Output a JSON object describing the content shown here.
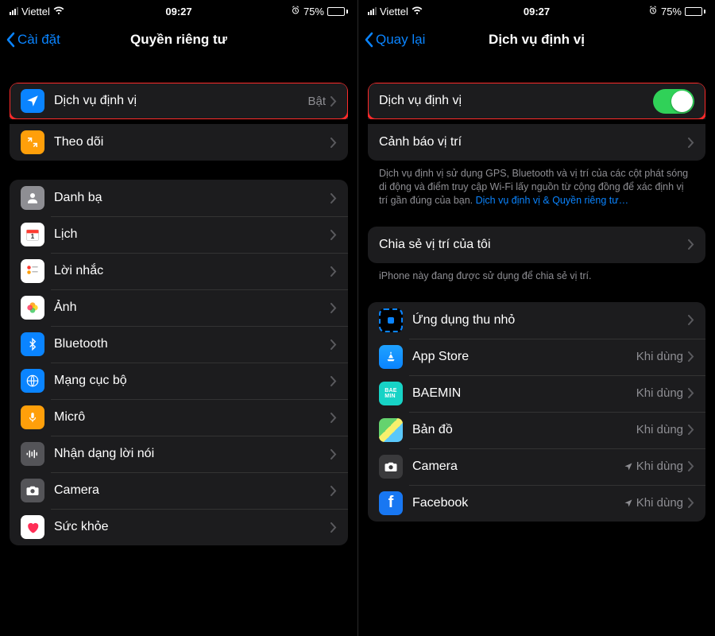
{
  "status": {
    "carrier": "Viettel",
    "time": "09:27",
    "battery_pct": "75%"
  },
  "left": {
    "back": "Cài đặt",
    "title": "Quyền riêng tư",
    "group1": [
      {
        "label": "Dịch vụ định vị",
        "value": "Bật",
        "icon": "location",
        "bg": "bg-blue"
      },
      {
        "label": "Theo dõi",
        "icon": "tracking",
        "bg": "bg-orange"
      }
    ],
    "group2": [
      {
        "label": "Danh bạ",
        "icon": "contacts"
      },
      {
        "label": "Lịch",
        "icon": "calendar"
      },
      {
        "label": "Lời nhắc",
        "icon": "reminders"
      },
      {
        "label": "Ảnh",
        "icon": "photos"
      },
      {
        "label": "Bluetooth",
        "icon": "bluetooth",
        "bg": "bg-blue"
      },
      {
        "label": "Mạng cục bộ",
        "icon": "network",
        "bg": "bg-blue"
      },
      {
        "label": "Micrô",
        "icon": "mic",
        "bg": "bg-orange"
      },
      {
        "label": "Nhận dạng lời nói",
        "icon": "speech",
        "bg": "bg-dgray"
      },
      {
        "label": "Camera",
        "icon": "camera",
        "bg": "bg-dgray"
      },
      {
        "label": "Sức khỏe",
        "icon": "health"
      }
    ]
  },
  "right": {
    "back": "Quay lại",
    "title": "Dịch vụ định vị",
    "toggle_label": "Dịch vụ định vị",
    "alerts_label": "Cảnh báo vị trí",
    "desc": "Dịch vụ định vị sử dụng GPS, Bluetooth và vị trí của các cột phát sóng di động và điểm truy cập Wi-Fi lấy nguồn từ cộng đồng để xác định vị trí gần đúng của bạn. ",
    "desc_link": "Dịch vụ định vị & Quyền riêng tư…",
    "share_label": "Chia sẻ vị trí của tôi",
    "share_footer": "iPhone này đang được sử dụng để chia sẻ vị trí.",
    "apps": [
      {
        "label": "Ứng dụng thu nhỏ",
        "value": "",
        "icon": "appclip"
      },
      {
        "label": "App Store",
        "value": "Khi dùng",
        "icon": "appstore"
      },
      {
        "label": "BAEMIN",
        "value": "Khi dùng",
        "icon": "baemin"
      },
      {
        "label": "Bản đồ",
        "value": "Khi dùng",
        "icon": "maps"
      },
      {
        "label": "Camera",
        "value": "Khi dùng",
        "icon": "camera-app",
        "arrow": true
      },
      {
        "label": "Facebook",
        "value": "Khi dùng",
        "icon": "facebook",
        "arrow": true
      }
    ]
  }
}
